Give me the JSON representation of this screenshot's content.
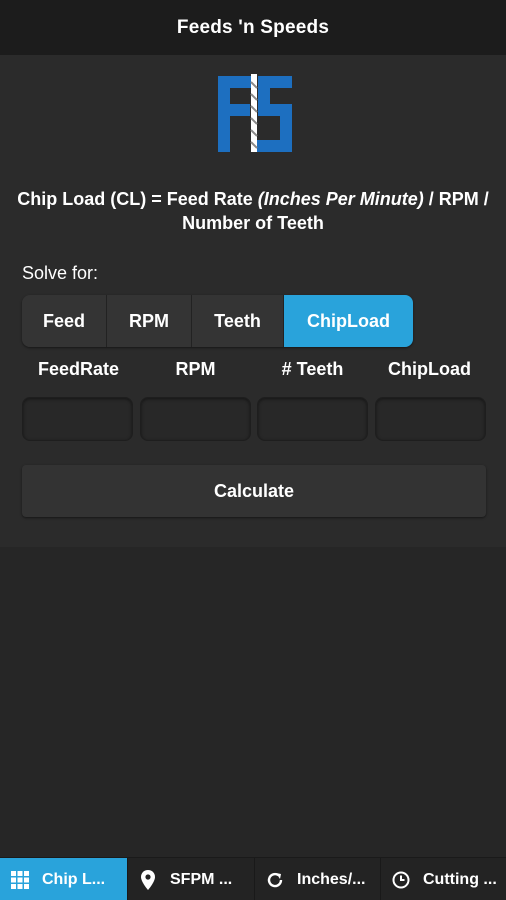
{
  "header": {
    "title": "Feeds 'n Speeds"
  },
  "formula": {
    "prefix": "Chip Load (CL) = Feed Rate ",
    "italic": "(Inches Per Minute)",
    "suffix": " / RPM / Number of Teeth"
  },
  "solve": {
    "label": "Solve for:",
    "options": [
      "Feed",
      "RPM",
      "Teeth",
      "ChipLoad"
    ],
    "selected": "ChipLoad"
  },
  "columns": [
    "FeedRate",
    "RPM",
    "# Teeth",
    "ChipLoad"
  ],
  "inputs": [
    {
      "value": "",
      "placeholder": ""
    },
    {
      "value": "",
      "placeholder": ""
    },
    {
      "value": "",
      "placeholder": ""
    },
    {
      "value": "",
      "placeholder": ""
    }
  ],
  "calculate_label": "Calculate",
  "tabs": [
    {
      "label": "Chip L...",
      "icon": "grid-icon",
      "active": true
    },
    {
      "label": "SFPM ...",
      "icon": "location-pin-icon",
      "active": false
    },
    {
      "label": "Inches/...",
      "icon": "refresh-icon",
      "active": false
    },
    {
      "label": "Cutting ...",
      "icon": "clock-icon",
      "active": false
    }
  ],
  "colors": {
    "accent": "#29a3db",
    "header_bg": "#1c1c1c",
    "content_bg": "#2b2b2b",
    "page_bg": "#262626",
    "logo_blue": "#1d6fc0"
  }
}
